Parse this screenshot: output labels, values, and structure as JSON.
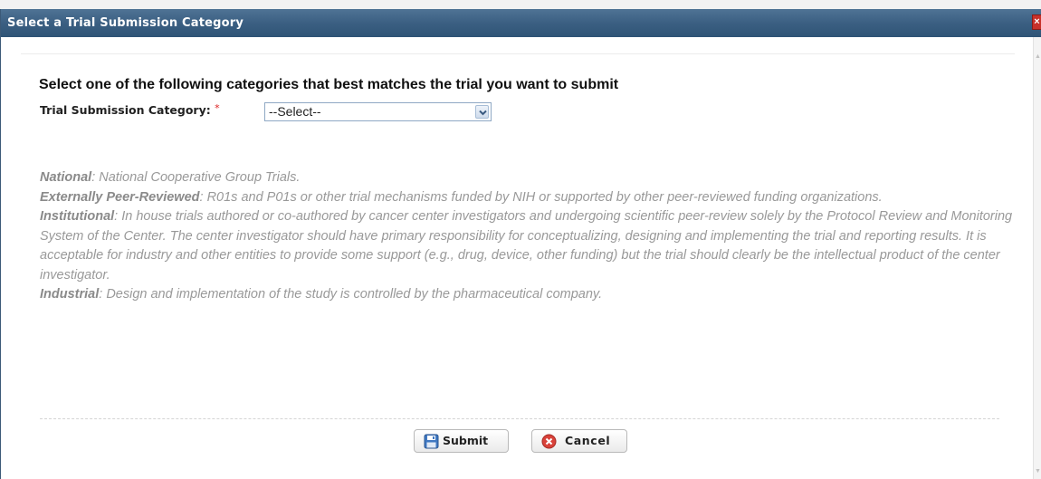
{
  "dialog": {
    "title": "Select a Trial Submission Category",
    "close_label": "×"
  },
  "form": {
    "heading": "Select one of the following categories that best matches the trial you want to submit",
    "field_label": "Trial Submission Category:",
    "required_marker": "*",
    "select_value": "--Select--"
  },
  "descriptions": [
    {
      "term": "National",
      "text": ": National Cooperative Group Trials."
    },
    {
      "term": "Externally Peer-Reviewed",
      "text": ": R01s and P01s or other trial mechanisms funded by NIH or supported by other peer-reviewed funding organizations."
    },
    {
      "term": "Institutional",
      "text": ": In house trials authored or co-authored by cancer center investigators and undergoing scientific peer-review solely by the Protocol Review and Monitoring System of the Center. The center investigator should have primary responsibility for conceptualizing, designing and implementing the trial and reporting results. It is acceptable for industry and other entities to provide some support (e.g., drug, device, other funding) but the trial should clearly be the intellectual product of the center investigator."
    },
    {
      "term": "Industrial",
      "text": ": Design and implementation of the study is controlled by the pharmaceutical company."
    }
  ],
  "buttons": {
    "submit": {
      "label": "Submit",
      "icon": "save-icon"
    },
    "cancel": {
      "label": "Cancel",
      "icon": "cancel-icon"
    }
  },
  "colors": {
    "titlebar": "#3b5f82",
    "close": "#c8312a",
    "description_text": "#999999",
    "required": "#dd2222"
  }
}
